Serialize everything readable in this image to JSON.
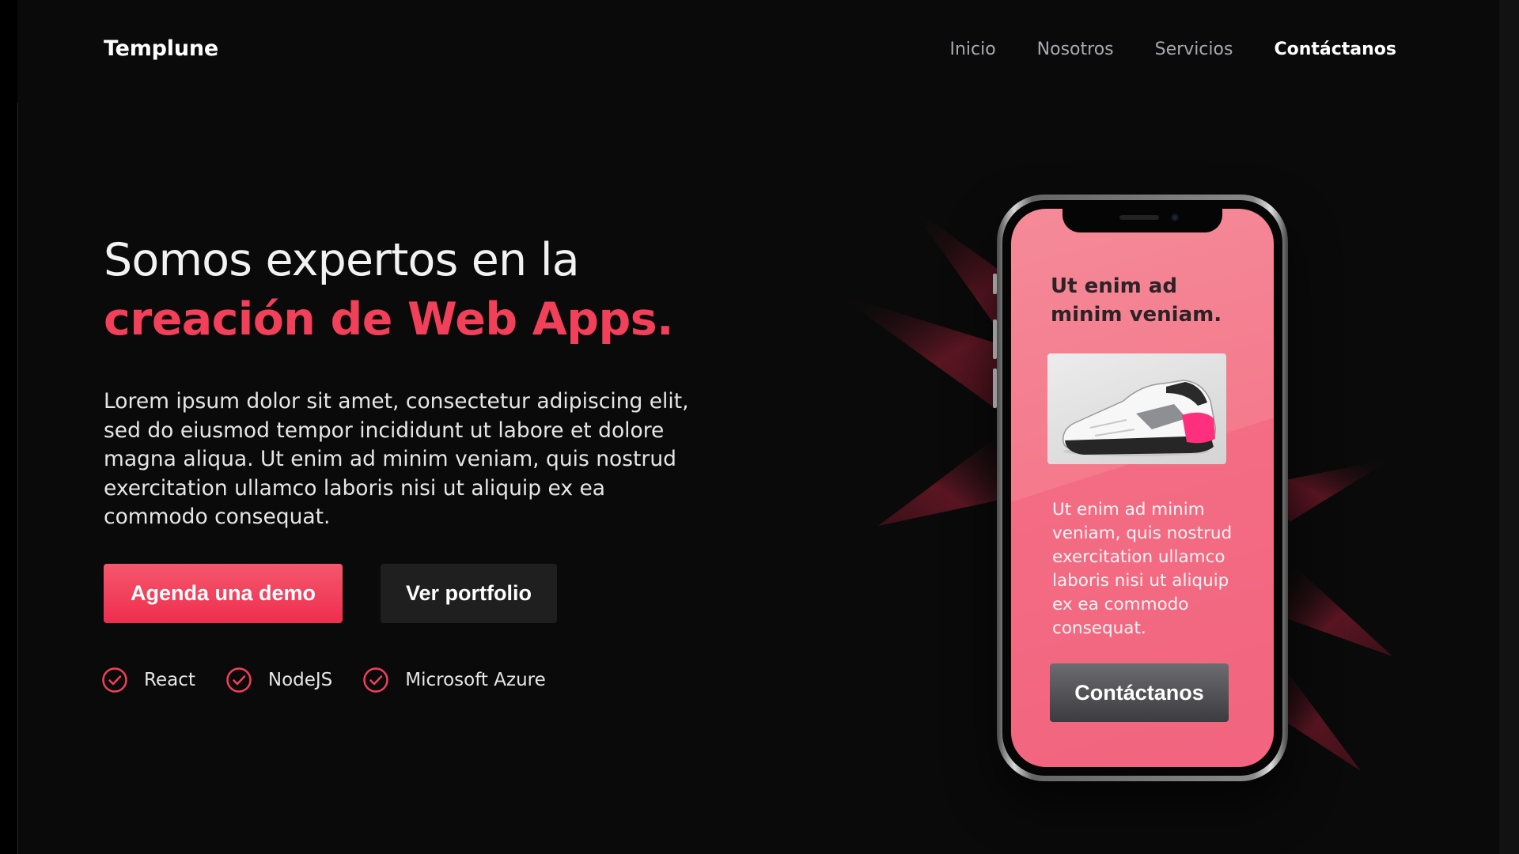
{
  "header": {
    "brand": "Templune",
    "nav": [
      {
        "label": "Inicio"
      },
      {
        "label": "Nosotros"
      },
      {
        "label": "Servicios"
      },
      {
        "label": "Contáctanos",
        "active": true
      }
    ]
  },
  "hero": {
    "headline_line1": "Somos expertos en la",
    "headline_accent": "creación de Web Apps.",
    "lead": "Lorem ipsum dolor sit amet, consectetur adipiscing elit, sed do eiusmod tempor incididunt ut labore et dolore magna aliqua. Ut enim ad minim veniam, quis nostrud exercitation ullamco laboris nisi ut aliquip ex ea commodo consequat.",
    "primary_button": "Agenda una demo",
    "secondary_button": "Ver portfolio",
    "tech": [
      {
        "label": "React",
        "icon": "check-circle-icon"
      },
      {
        "label": "NodeJS",
        "icon": "check-circle-icon"
      },
      {
        "label": "Microsoft Azure",
        "icon": "check-circle-icon"
      }
    ]
  },
  "phone": {
    "card_title": "Ut enim ad minim veniam.",
    "card_text": "Ut enim ad minim veniam, quis nostrud exercitation ullamco laboris nisi ut aliquip ex ea commodo consequat.",
    "card_button": "Contáctanos",
    "product_image": "sneaker-image"
  },
  "colors": {
    "background": "#0a0a0a",
    "accent": "#f23f5a",
    "screen_pink": "#f47a8c",
    "secondary_button": "#1f1f1f"
  }
}
